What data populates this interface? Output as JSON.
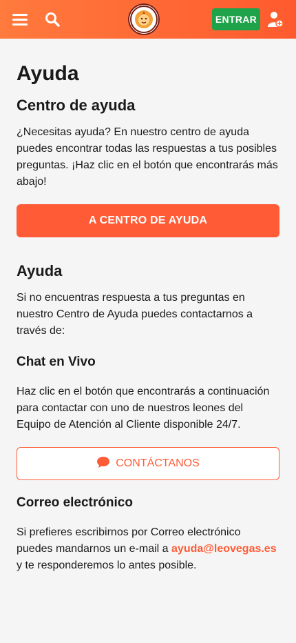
{
  "header": {
    "login_label": "ENTRAR",
    "icons": {
      "menu": "hamburger-menu-icon",
      "search": "search-icon",
      "logo": "lion-logo-icon",
      "account": "user-add-icon"
    },
    "colors": {
      "bar": "#ff6a35",
      "login_button": "#1fa34a"
    }
  },
  "main": {
    "page_title": "Ayuda",
    "help_center": {
      "title": "Centro de ayuda",
      "text": "¿Necesitas ayuda? En nuestro centro de ayuda puedes encontrar todas las respuestas a tus posibles preguntas. ¡Haz clic en el botón que encontrarás más abajo!",
      "button_label": "A CENTRO DE AYUDA"
    },
    "help": {
      "title": "Ayuda",
      "text": "Si no encuentras respuesta a tus preguntas en nuestro Centro de Ayuda puedes contactarnos a través de:"
    },
    "chat": {
      "title": "Chat en Vivo",
      "text": "Haz clic en el botón que encontrarás a continuación para contactar con uno de nuestros leones del Equipo de Atención al Cliente disponible 24/7.",
      "button_label": "CONTÁCTANOS",
      "button_icon": "chat-bubble-icon"
    },
    "email": {
      "title": "Correo electrónico",
      "text_before": "Si prefieres escribirnos por Correo electrónico puedes mandarnos un e-mail a ",
      "email": "ayuda@leovegas.es",
      "text_after": " y te responderemos lo antes posible."
    },
    "accent_color": "#ff5b36"
  }
}
